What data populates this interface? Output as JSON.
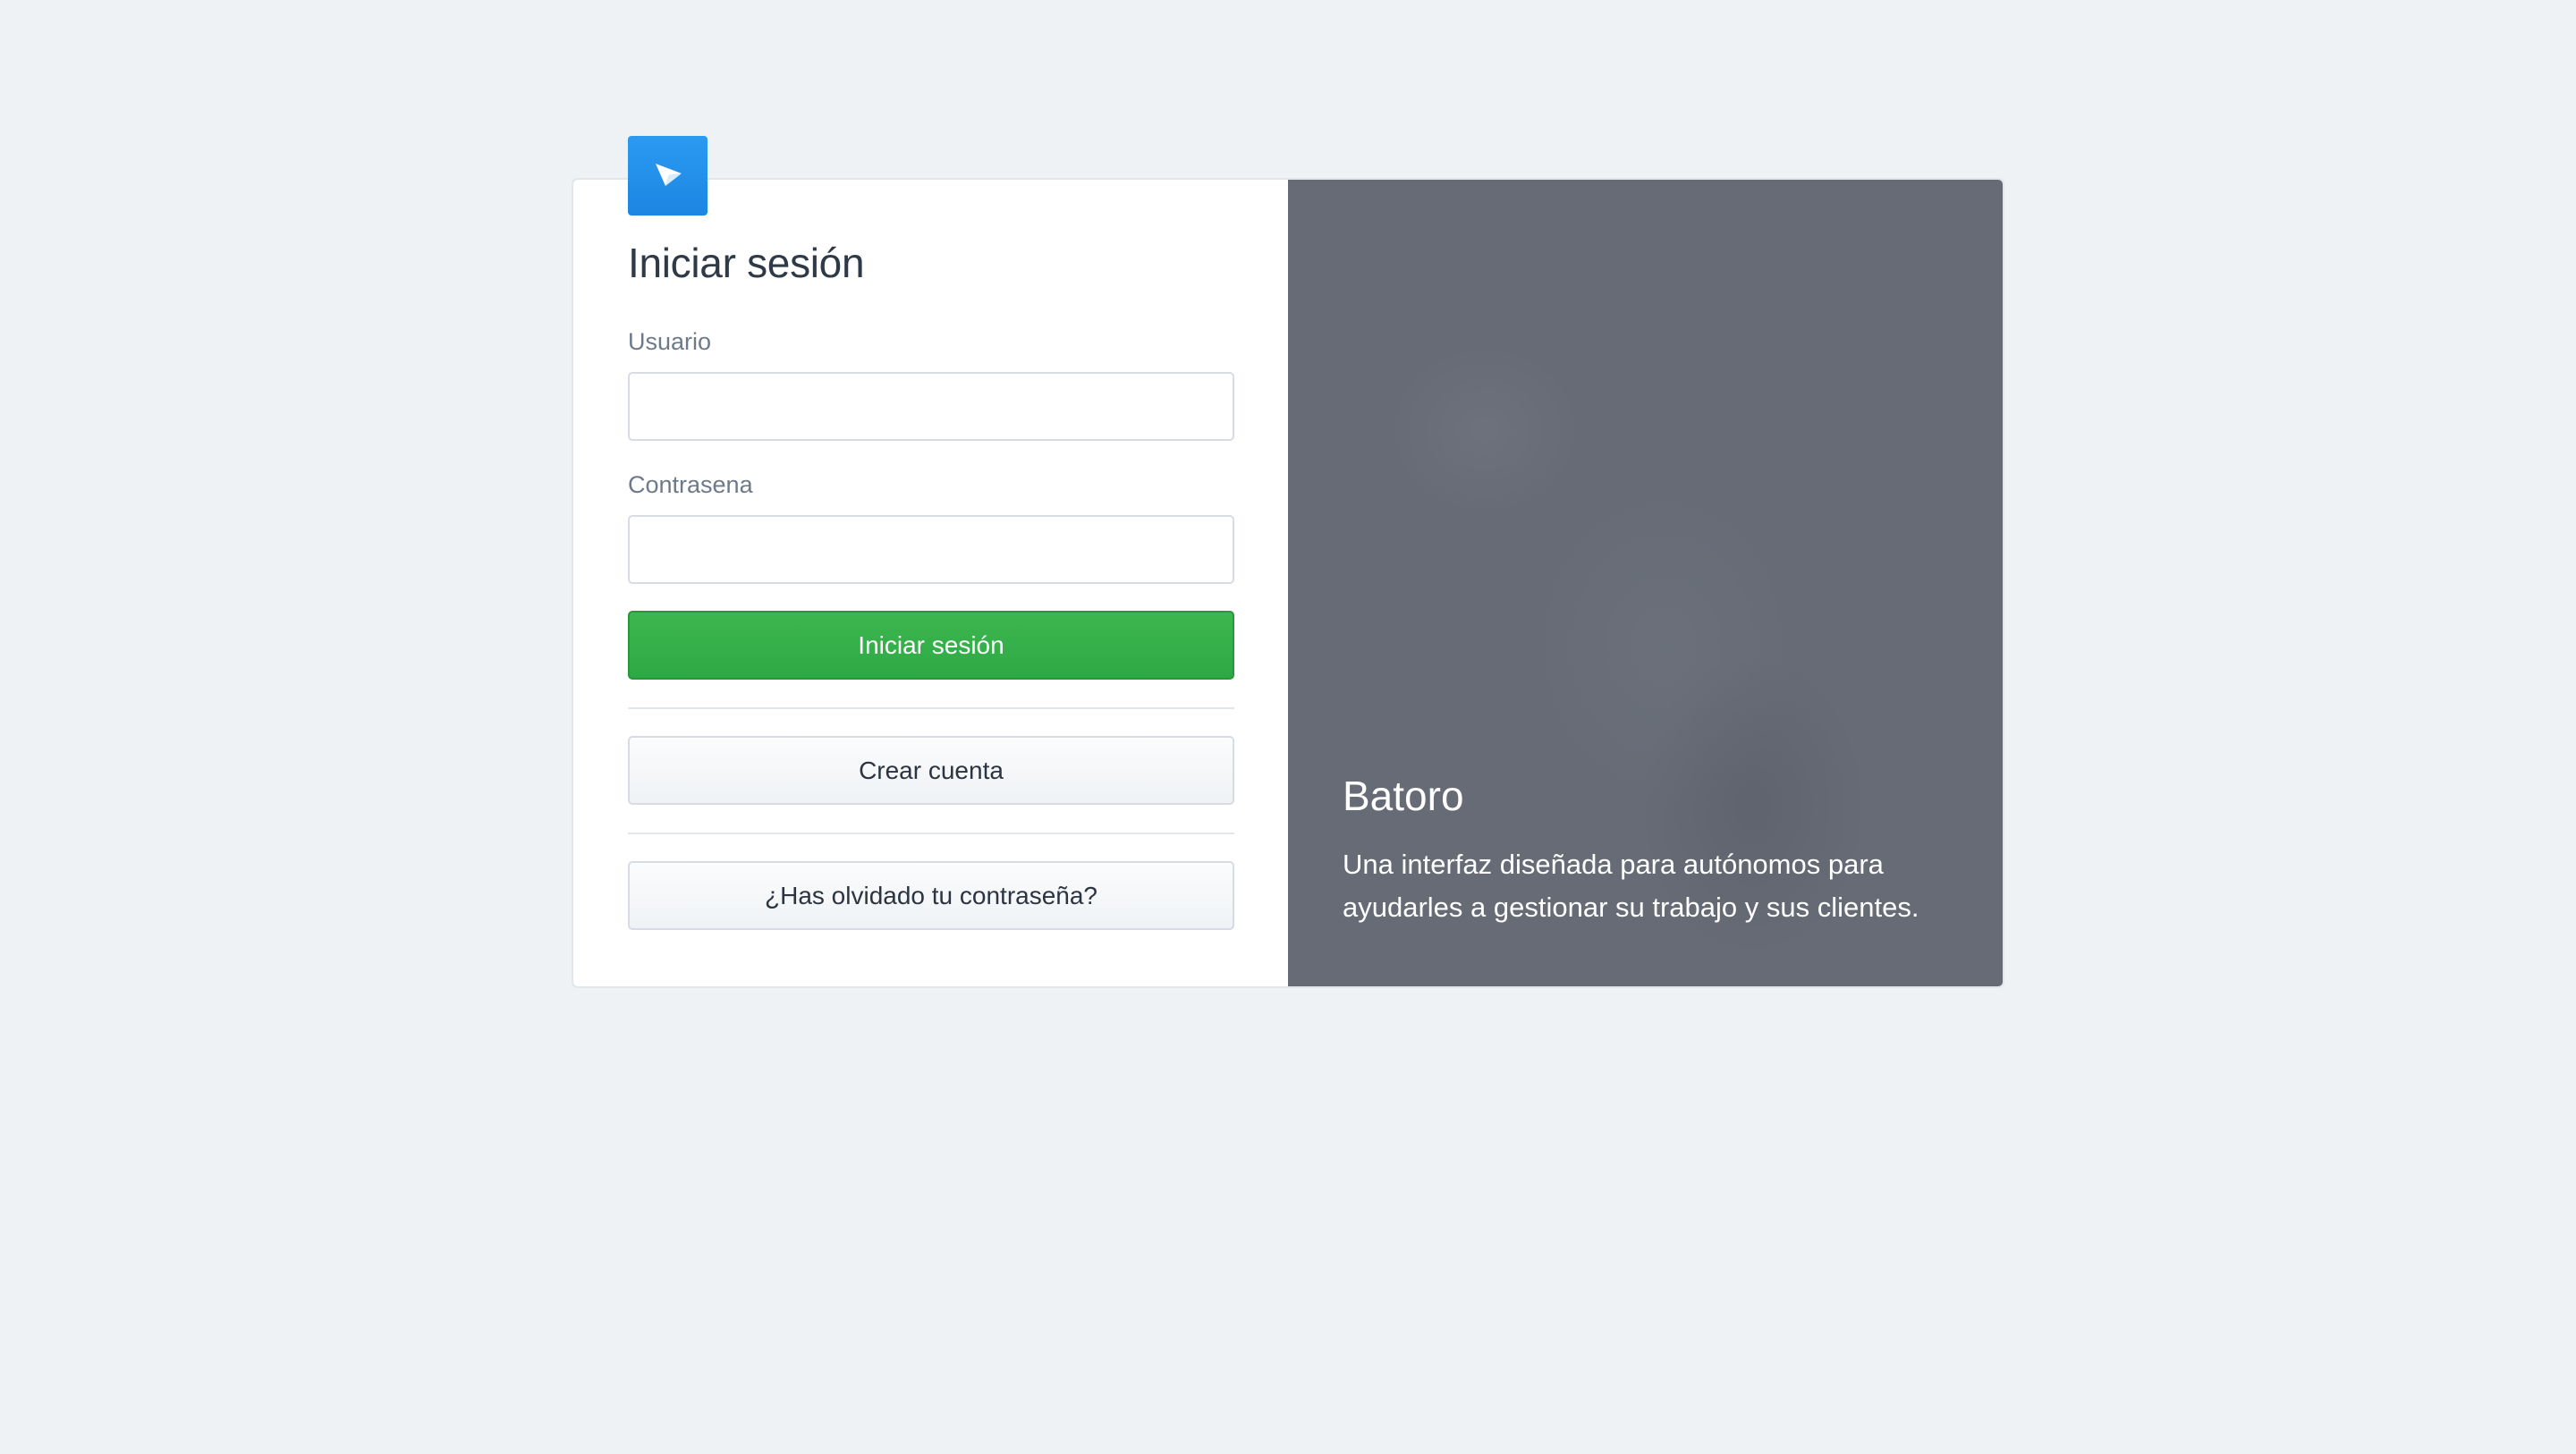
{
  "login": {
    "title": "Iniciar sesión",
    "username_label": "Usuario",
    "username_value": "",
    "password_label": "Contrasena",
    "password_value": "",
    "submit_label": "Iniciar sesión",
    "create_account_label": "Crear cuenta",
    "forgot_password_label": "¿Has olvidado tu contraseña?"
  },
  "brand": {
    "name": "Batoro",
    "description": "Una interfaz diseñada para autónomos para ayudarles a gestionar su trabajo y sus clientes."
  },
  "icons": {
    "logo": "paper-plane-icon"
  },
  "colors": {
    "background": "#eef2f5",
    "accent_blue": "#2192ea",
    "primary_green": "#35b04a",
    "panel_gray": "#666b76",
    "text_dark": "#2f3a48",
    "label_gray": "#6c7a8a"
  }
}
